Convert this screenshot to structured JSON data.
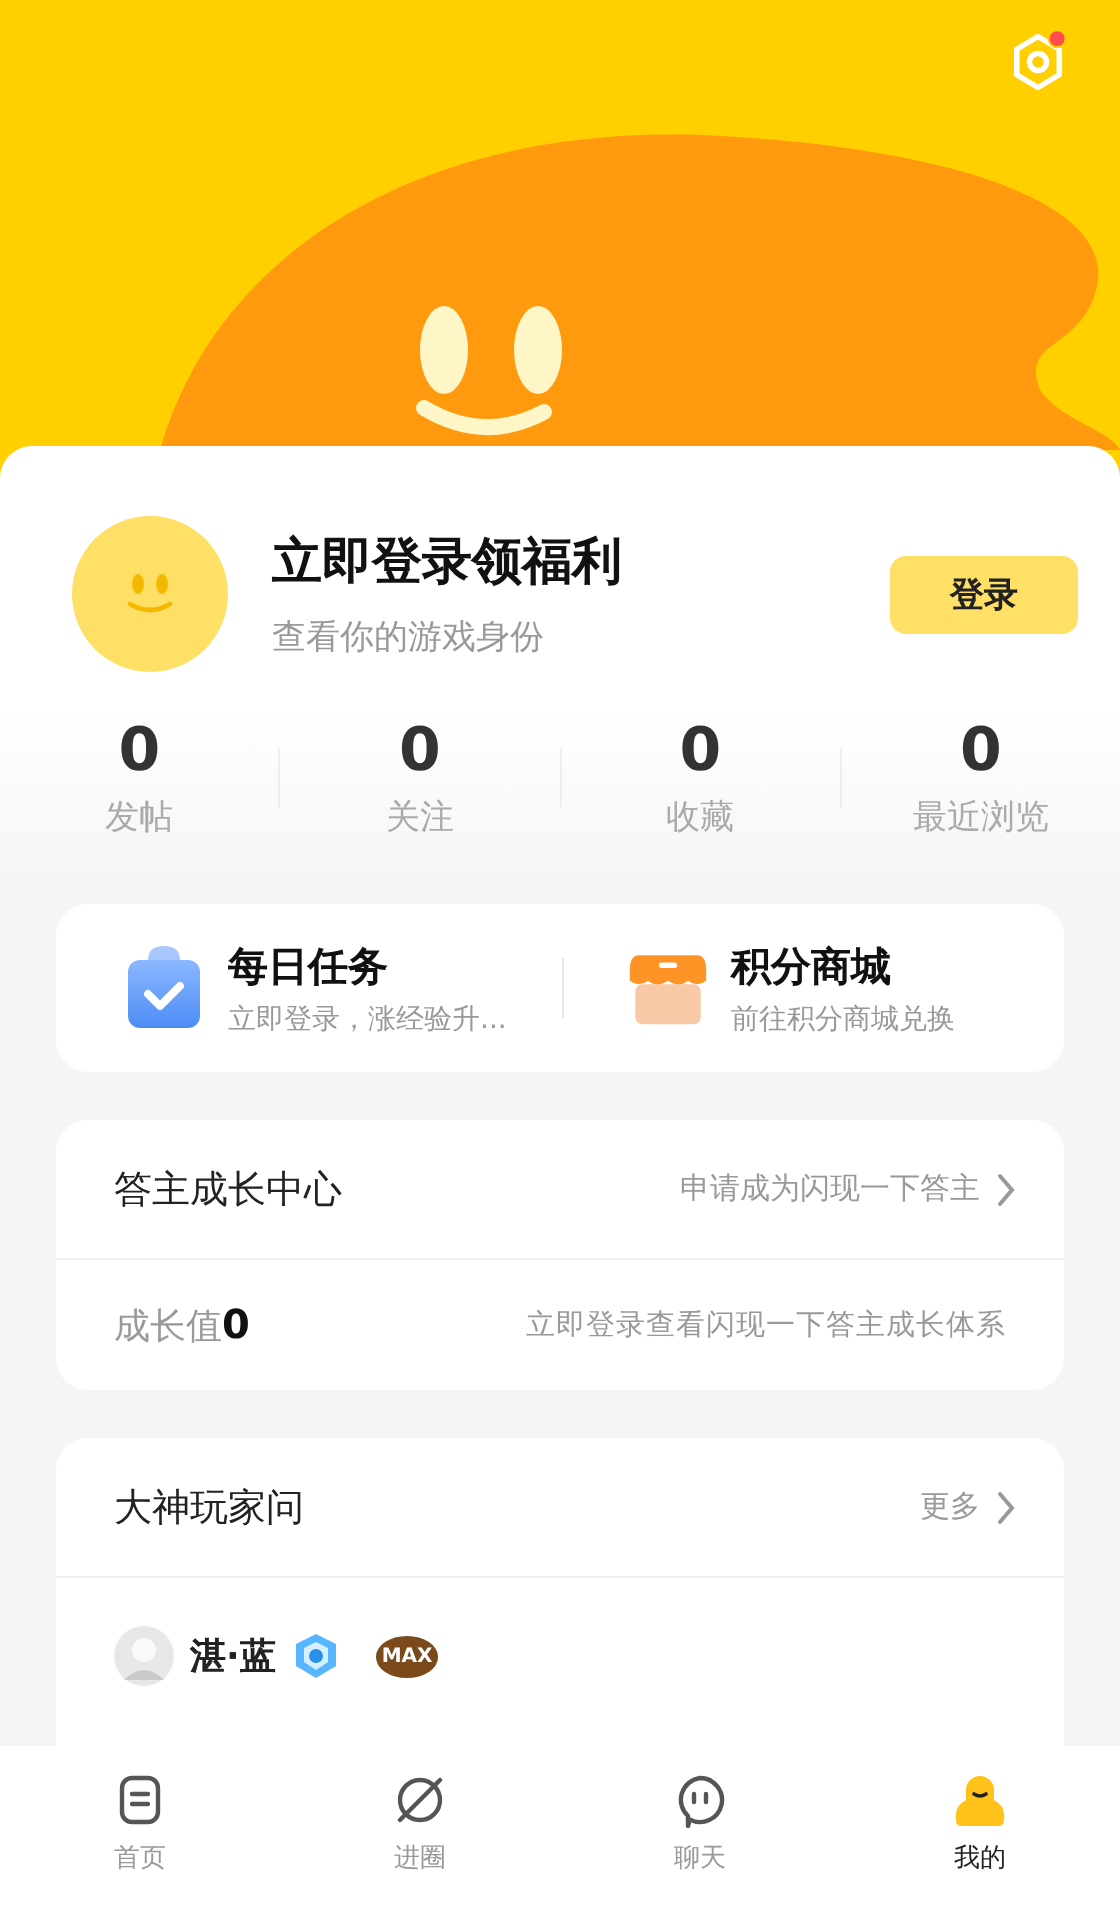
{
  "profile": {
    "title": "立即登录领福利",
    "subtitle": "查看你的游戏身份",
    "login_button": "登录"
  },
  "stats": [
    {
      "value": "0",
      "label": "发帖"
    },
    {
      "value": "0",
      "label": "关注"
    },
    {
      "value": "0",
      "label": "收藏"
    },
    {
      "value": "0",
      "label": "最近浏览"
    }
  ],
  "shortcuts": [
    {
      "kind": "tasks",
      "title": "每日任务",
      "subtitle": "立即登录，涨经验升..."
    },
    {
      "kind": "shop",
      "title": "积分商城",
      "subtitle": "前往积分商城兑换"
    }
  ],
  "answer_center": {
    "title": "答主成长中心",
    "link": "申请成为闪现一下答主",
    "growth_label": "成长值",
    "growth_value": "0",
    "growth_hint": "立即登录查看闪现一下答主成长体系"
  },
  "questions": {
    "title": "大神玩家问",
    "more": "更多",
    "user": {
      "name": "湛·蓝",
      "badge": "MAX"
    }
  },
  "tabs": [
    {
      "kind": "home",
      "label": "首页",
      "selected": false
    },
    {
      "kind": "circle",
      "label": "进圈",
      "selected": false
    },
    {
      "kind": "chat",
      "label": "聊天",
      "selected": false
    },
    {
      "kind": "me",
      "label": "我的",
      "selected": true
    }
  ]
}
